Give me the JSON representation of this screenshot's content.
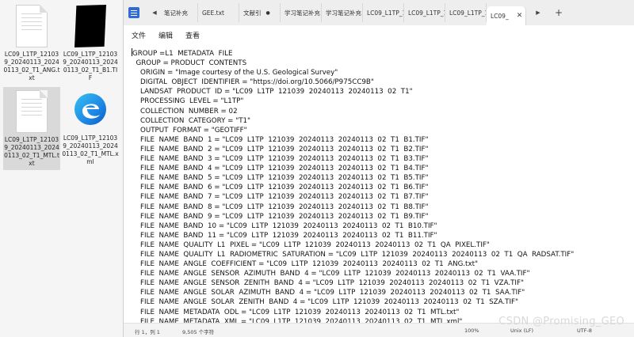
{
  "desktop": {
    "files": [
      {
        "name": "LC09_L1TP_121039_20240113_20240113_02_T1_ANG.txt",
        "icon": "text-file-icon"
      },
      {
        "name": "LC09_L1TP_121039_20240113_20240113_02_T1_B1.TIF",
        "icon": "tif-image-icon"
      },
      {
        "name": "LC09_L1TP_121039_20240113_20240113_02_T1_MTL.txt",
        "icon": "text-file-icon",
        "selected": true
      },
      {
        "name": "LC09_L1TP_121039_20240113_20240113_02_T1_MTL.xml",
        "icon": "edge-browser-icon"
      }
    ]
  },
  "tabs": [
    {
      "label": "笔记补充"
    },
    {
      "label": "GEE.txt"
    },
    {
      "label": "文献引",
      "modified": true
    },
    {
      "label": "学习笔记补充"
    },
    {
      "label": "学习笔记补充"
    },
    {
      "label": "LC09_L1TP_12"
    },
    {
      "label": "LC09_L1TP_12"
    },
    {
      "label": "LC09_L1TP_12"
    },
    {
      "label": "LC09_",
      "active": true
    }
  ],
  "menu": {
    "file": "文件",
    "edit": "编辑",
    "view": "查看"
  },
  "editor_lines": [
    "GROUP =L1  METADATA  FILE",
    "  GROUP = PRODUCT  CONTENTS",
    "    ORIGIN = \"Image courtesy of the U.S. Geological Survey\"",
    "    DIGITAL  OBJECT  IDENTIFIER = \"https://doi.org/10.5066/P975CC9B\"",
    "    LANDSAT  PRODUCT  ID = \"LC09  L1TP  121039  20240113  20240113  02  T1\"",
    "    PROCESSING  LEVEL = \"L1TP\"",
    "    COLLECTION  NUMBER = 02",
    "    COLLECTION  CATEGORY = \"T1\"",
    "    OUTPUT  FORMAT = \"GEOTIFF\"",
    "    FILE  NAME  BAND  1 = \"LC09  L1TP  121039  20240113  20240113  02  T1  B1.TIF\"",
    "    FILE  NAME  BAND  2 = \"LC09  L1TP  121039  20240113  20240113  02  T1  B2.TIF\"",
    "    FILE  NAME  BAND  3 = \"LC09  L1TP  121039  20240113  20240113  02  T1  B3.TIF\"",
    "    FILE  NAME  BAND  4 = \"LC09  L1TP  121039  20240113  20240113  02  T1  B4.TIF\"",
    "    FILE  NAME  BAND  5 = \"LC09  L1TP  121039  20240113  20240113  02  T1  B5.TIF\"",
    "    FILE  NAME  BAND  6 = \"LC09  L1TP  121039  20240113  20240113  02  T1  B6.TIF\"",
    "    FILE  NAME  BAND  7 = \"LC09  L1TP  121039  20240113  20240113  02  T1  B7.TIF\"",
    "    FILE  NAME  BAND  8 = \"LC09  L1TP  121039  20240113  20240113  02  T1  B8.TIF\"",
    "    FILE  NAME  BAND  9 = \"LC09  L1TP  121039  20240113  20240113  02  T1  B9.TIF\"",
    "    FILE  NAME  BAND  10 = \"LC09  L1TP  121039  20240113  20240113  02  T1  B10.TIF\"",
    "    FILE  NAME  BAND  11 = \"LC09  L1TP  121039  20240113  20240113  02  T1  B11.TIF\"",
    "    FILE  NAME  QUALITY  L1  PIXEL = \"LC09  L1TP  121039  20240113  20240113  02  T1  QA  PIXEL.TIF\"",
    "    FILE  NAME  QUALITY  L1  RADIOMETRIC  SATURATION = \"LC09  L1TP  121039  20240113  20240113  02  T1  QA  RADSAT.TIF\"",
    "    FILE  NAME  ANGLE  COEFFICIENT = \"LC09  L1TP  121039  20240113  20240113  02  T1  ANG.txt\"",
    "    FILE  NAME  ANGLE  SENSOR  AZIMUTH  BAND  4 = \"LC09  L1TP  121039  20240113  20240113  02  T1  VAA.TIF\"",
    "    FILE  NAME  ANGLE  SENSOR  ZENITH  BAND  4 = \"LC09  L1TP  121039  20240113  20240113  02  T1  VZA.TIF\"",
    "    FILE  NAME  ANGLE  SOLAR  AZIMUTH  BAND  4 = \"LC09  L1TP  121039  20240113  20240113  02  T1  SAA.TIF\"",
    "    FILE  NAME  ANGLE  SOLAR  ZENITH  BAND  4 = \"LC09  L1TP  121039  20240113  20240113  02  T1  SZA.TIF\"",
    "    FILE  NAME  METADATA  ODL = \"LC09  L1TP  121039  20240113  20240113  02  T1  MTL.txt\"",
    "    FILE  NAME  METADATA  XML = \"LC09  L1TP  121039  20240113  20240113  02  T1  MTL.xml\""
  ],
  "status": {
    "position": "行 1，列 1",
    "char_count": "9,505 个字符",
    "zoom": "100%",
    "line_ending": "Unix (LF)",
    "encoding": "UTF-8"
  },
  "watermark": "CSDN @Promising_GEO"
}
